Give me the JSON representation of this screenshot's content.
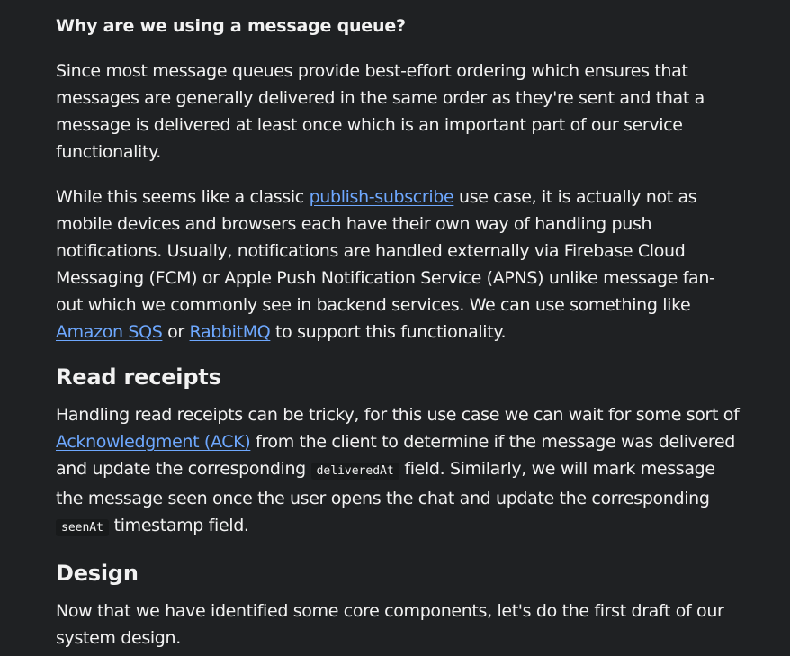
{
  "question": "Why are we using a message queue?",
  "p1": "Since most message queues provide best-effort ordering which ensures that messages are generally delivered in the same order as they're sent and that a message is delivered at least once which is an important part of our service functionality.",
  "p2": {
    "t1": "While this seems like a classic ",
    "link1": "publish-subscribe",
    "t2": " use case, it is actually not as mobile devices and browsers each have their own way of handling push notifications. Usually, notifications are handled externally via Firebase Cloud Messaging (FCM) or Apple Push Notification Service (APNS) unlike message fan-out which we commonly see in backend services. We can use something like ",
    "link2": "Amazon SQS",
    "t3": " or ",
    "link3": "RabbitMQ",
    "t4": " to support this functionality."
  },
  "h_read": "Read receipts",
  "p3": {
    "t1": "Handling read receipts can be tricky, for this use case we can wait for some sort of ",
    "link1": "Acknowledgment (ACK)",
    "t2": " from the client to determine if the message was delivered and update the corresponding ",
    "code1": "deliveredAt",
    "t3": " field. Similarly, we will mark message the message seen once the user opens the chat and update the corresponding ",
    "code2": "seenAt",
    "t4": " timestamp field."
  },
  "h_design": "Design",
  "p4": "Now that we have identified some core components, let's do the first draft of our system design.",
  "colors": {
    "background": "#1f2123",
    "text": "#f2f2f2",
    "link": "#6ea8fe"
  }
}
